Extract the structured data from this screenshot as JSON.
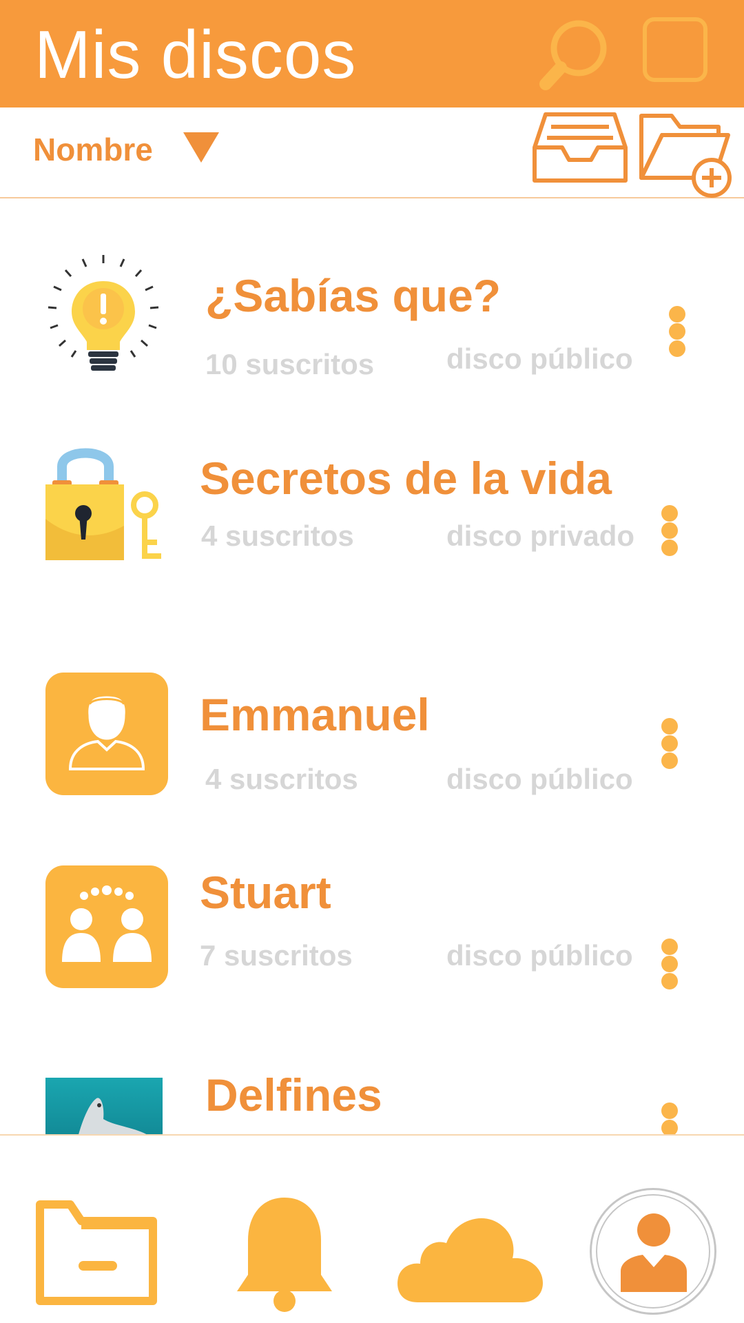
{
  "header": {
    "title": "Mis discos",
    "icons": [
      "search-icon",
      "select-square-icon"
    ]
  },
  "sortbar": {
    "label": "Nombre",
    "icons": [
      "dropdown-arrow-icon",
      "inbox-icon",
      "new-folder-icon"
    ]
  },
  "discs": [
    {
      "title": "¿Sabías que?",
      "subscribers": "10 suscritos",
      "visibility": "disco público",
      "icon": "lightbulb-icon"
    },
    {
      "title": "Secretos de la vida",
      "subscribers": "4 suscritos",
      "visibility": "disco privado",
      "icon": "lock-key-icon"
    },
    {
      "title": "Emmanuel",
      "subscribers": "4 suscritos",
      "visibility": "disco público",
      "icon": "user-avatar-icon"
    },
    {
      "title": "Stuart",
      "subscribers": "7 suscritos",
      "visibility": "disco público",
      "icon": "group-avatar-icon"
    },
    {
      "title": "Delfines",
      "icon": "dolphin-photo"
    }
  ],
  "bottom_nav": {
    "items": [
      "folder-icon",
      "bell-icon",
      "cloud-icon",
      "profile-icon"
    ]
  },
  "colors": {
    "primary": "#f79a3c",
    "accent": "#fbb54a",
    "muted_text": "#d6d6d6"
  }
}
